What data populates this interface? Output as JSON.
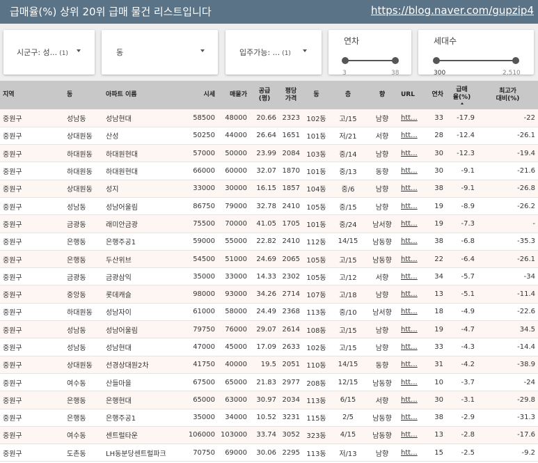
{
  "header": {
    "title": "급매율(%) 상위 20위 급매 물건 리스트입니다",
    "link": "https://blog.naver.com/gupzip4"
  },
  "filters": {
    "sigungu": {
      "label": "시군구: 성...",
      "count": "(1)"
    },
    "dong": {
      "label": "동"
    },
    "movein": {
      "label": "입주가능: ...",
      "count": "(1)"
    },
    "age": {
      "title": "연차",
      "min": "3",
      "max": "38"
    },
    "households": {
      "title": "세대수",
      "min": "300",
      "max": "2,510"
    }
  },
  "table": {
    "headers": {
      "region": "지역",
      "dong": "동",
      "apt": "아파트 이름",
      "price": "시세",
      "listing": "매물가",
      "area": "공급\n(평)",
      "ppp": "평당\n가격",
      "building": "동",
      "floor": "층",
      "direction": "향",
      "url": "URL",
      "age": "연차",
      "rate": "급매\n율(%)",
      "vsmax": "최고가\n대비(%)"
    },
    "rows": [
      {
        "region": "중원구",
        "dong": "성남동",
        "apt": "성남현대",
        "price": "58500",
        "listing": "48000",
        "area": "20.66",
        "ppp": "2323",
        "building": "102동",
        "floor": "고/15",
        "direction": "남향",
        "url": "htt...",
        "age": "33",
        "rate": "-17.9",
        "vsmax": "-22"
      },
      {
        "region": "중원구",
        "dong": "상대원동",
        "apt": "산성",
        "price": "50250",
        "listing": "44000",
        "area": "26.64",
        "ppp": "1651",
        "building": "101동",
        "floor": "저/21",
        "direction": "서향",
        "url": "htt...",
        "age": "28",
        "rate": "-12.4",
        "vsmax": "-26.1"
      },
      {
        "region": "중원구",
        "dong": "하대원동",
        "apt": "하대원현대",
        "price": "57000",
        "listing": "50000",
        "area": "23.99",
        "ppp": "2084",
        "building": "103동",
        "floor": "중/14",
        "direction": "남향",
        "url": "htt...",
        "age": "30",
        "rate": "-12.3",
        "vsmax": "-19.4"
      },
      {
        "region": "중원구",
        "dong": "하대원동",
        "apt": "하대원현대",
        "price": "66000",
        "listing": "60000",
        "area": "32.07",
        "ppp": "1870",
        "building": "101동",
        "floor": "중/13",
        "direction": "동향",
        "url": "htt...",
        "age": "30",
        "rate": "-9.1",
        "vsmax": "-21.6"
      },
      {
        "region": "중원구",
        "dong": "상대원동",
        "apt": "성지",
        "price": "33000",
        "listing": "30000",
        "area": "16.15",
        "ppp": "1857",
        "building": "104동",
        "floor": "중/6",
        "direction": "남향",
        "url": "htt...",
        "age": "38",
        "rate": "-9.1",
        "vsmax": "-26.8"
      },
      {
        "region": "중원구",
        "dong": "성남동",
        "apt": "성남어울림",
        "price": "86750",
        "listing": "79000",
        "area": "32.78",
        "ppp": "2410",
        "building": "105동",
        "floor": "중/15",
        "direction": "남향",
        "url": "htt...",
        "age": "19",
        "rate": "-8.9",
        "vsmax": "-26.2"
      },
      {
        "region": "중원구",
        "dong": "금광동",
        "apt": "래미안금광",
        "price": "75500",
        "listing": "70000",
        "area": "41.05",
        "ppp": "1705",
        "building": "101동",
        "floor": "중/24",
        "direction": "남서향",
        "url": "htt...",
        "age": "19",
        "rate": "-7.3",
        "vsmax": "-"
      },
      {
        "region": "중원구",
        "dong": "은행동",
        "apt": "은행주공1",
        "price": "59000",
        "listing": "55000",
        "area": "22.82",
        "ppp": "2410",
        "building": "112동",
        "floor": "14/15",
        "direction": "남동향",
        "url": "htt...",
        "age": "38",
        "rate": "-6.8",
        "vsmax": "-35.3"
      },
      {
        "region": "중원구",
        "dong": "은행동",
        "apt": "두산위브",
        "price": "54500",
        "listing": "51000",
        "area": "24.69",
        "ppp": "2065",
        "building": "105동",
        "floor": "고/15",
        "direction": "남동향",
        "url": "htt...",
        "age": "22",
        "rate": "-6.4",
        "vsmax": "-26.1"
      },
      {
        "region": "중원구",
        "dong": "금광동",
        "apt": "금광삼익",
        "price": "35000",
        "listing": "33000",
        "area": "14.33",
        "ppp": "2302",
        "building": "105동",
        "floor": "고/12",
        "direction": "서향",
        "url": "htt...",
        "age": "34",
        "rate": "-5.7",
        "vsmax": "-34"
      },
      {
        "region": "중원구",
        "dong": "중앙동",
        "apt": "롯데캐슬",
        "price": "98000",
        "listing": "93000",
        "area": "34.26",
        "ppp": "2714",
        "building": "107동",
        "floor": "고/18",
        "direction": "남향",
        "url": "htt...",
        "age": "13",
        "rate": "-5.1",
        "vsmax": "-11.4"
      },
      {
        "region": "중원구",
        "dong": "하대원동",
        "apt": "성남자이",
        "price": "61000",
        "listing": "58000",
        "area": "24.49",
        "ppp": "2368",
        "building": "113동",
        "floor": "중/10",
        "direction": "남서향",
        "url": "htt...",
        "age": "18",
        "rate": "-4.9",
        "vsmax": "-22.6"
      },
      {
        "region": "중원구",
        "dong": "성남동",
        "apt": "성남어울림",
        "price": "79750",
        "listing": "76000",
        "area": "29.07",
        "ppp": "2614",
        "building": "108동",
        "floor": "고/15",
        "direction": "남향",
        "url": "htt...",
        "age": "19",
        "rate": "-4.7",
        "vsmax": "34.5"
      },
      {
        "region": "중원구",
        "dong": "성남동",
        "apt": "성남현대",
        "price": "47000",
        "listing": "45000",
        "area": "17.09",
        "ppp": "2633",
        "building": "102동",
        "floor": "고/15",
        "direction": "남향",
        "url": "htt...",
        "age": "33",
        "rate": "-4.3",
        "vsmax": "-14.4"
      },
      {
        "region": "중원구",
        "dong": "상대원동",
        "apt": "선경상대원2차",
        "price": "41750",
        "listing": "40000",
        "area": "19.5",
        "ppp": "2051",
        "building": "110동",
        "floor": "14/15",
        "direction": "동향",
        "url": "htt...",
        "age": "31",
        "rate": "-4.2",
        "vsmax": "-38.9"
      },
      {
        "region": "중원구",
        "dong": "여수동",
        "apt": "산들마을",
        "price": "67500",
        "listing": "65000",
        "area": "21.83",
        "ppp": "2977",
        "building": "208동",
        "floor": "12/15",
        "direction": "남동향",
        "url": "htt...",
        "age": "10",
        "rate": "-3.7",
        "vsmax": "-24"
      },
      {
        "region": "중원구",
        "dong": "은행동",
        "apt": "은행현대",
        "price": "65000",
        "listing": "63000",
        "area": "30.97",
        "ppp": "2034",
        "building": "113동",
        "floor": "6/15",
        "direction": "서향",
        "url": "htt...",
        "age": "30",
        "rate": "-3.1",
        "vsmax": "-29.8"
      },
      {
        "region": "중원구",
        "dong": "은행동",
        "apt": "은행주공1",
        "price": "35000",
        "listing": "34000",
        "area": "10.52",
        "ppp": "3231",
        "building": "115동",
        "floor": "2/5",
        "direction": "남동향",
        "url": "htt...",
        "age": "38",
        "rate": "-2.9",
        "vsmax": "-31.3"
      },
      {
        "region": "중원구",
        "dong": "여수동",
        "apt": "센트럴타운",
        "price": "106000",
        "listing": "103000",
        "area": "33.74",
        "ppp": "3052",
        "building": "323동",
        "floor": "4/15",
        "direction": "남동향",
        "url": "htt...",
        "age": "13",
        "rate": "-2.8",
        "vsmax": "-17.6"
      },
      {
        "region": "중원구",
        "dong": "도촌동",
        "apt": "LH동분당센트럴파크",
        "price": "70750",
        "listing": "69000",
        "area": "30.06",
        "ppp": "2295",
        "building": "113동",
        "floor": "저/13",
        "direction": "남향",
        "url": "htt...",
        "age": "15",
        "rate": "-2.5",
        "vsmax": "-9.2"
      }
    ]
  }
}
